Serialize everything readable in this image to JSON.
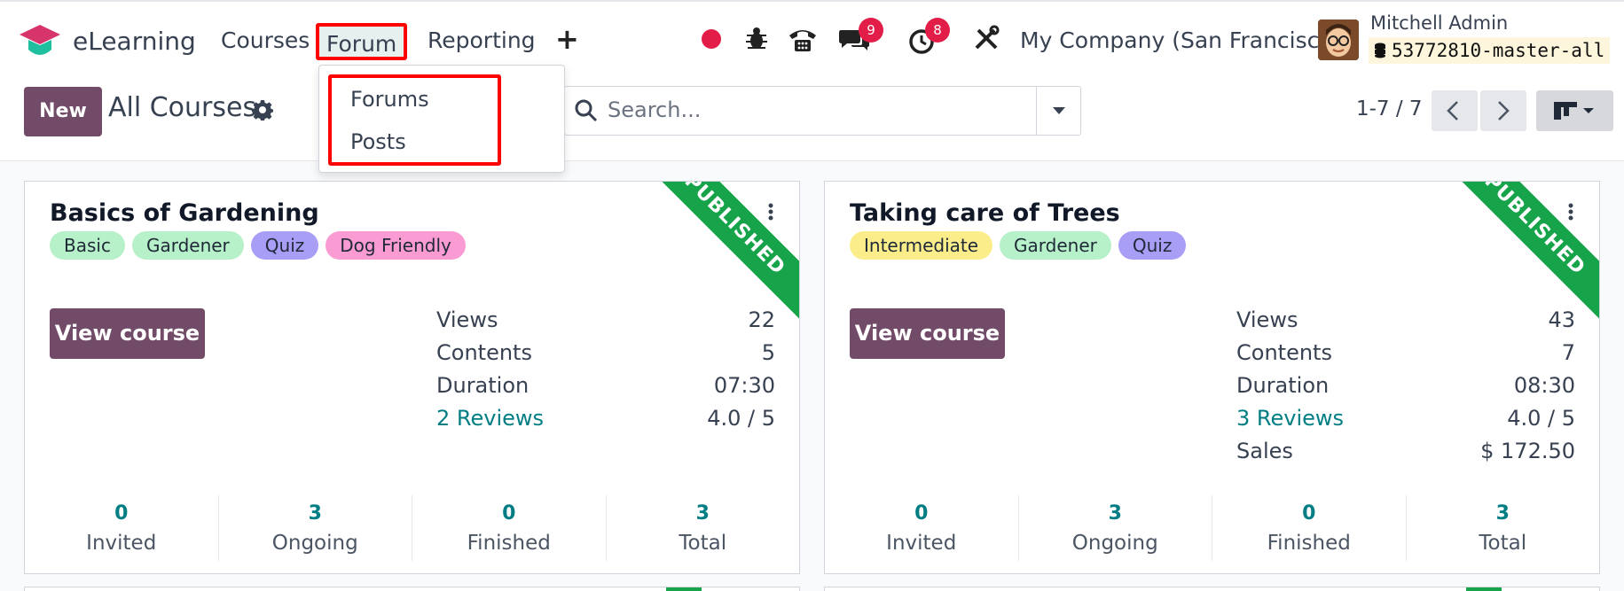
{
  "navbar": {
    "app_name": "eLearning",
    "menu": [
      "Courses",
      "Forum",
      "Reporting"
    ],
    "plus_label": "+",
    "chat_badge": "9",
    "activity_badge": "8",
    "company": "My Company (San Francisco)",
    "user_name": "Mitchell Admin",
    "database": "53772810-master-all"
  },
  "forum_dropdown": {
    "items": [
      "Forums",
      "Posts"
    ]
  },
  "control_panel": {
    "new_label": "New",
    "title": "All Courses",
    "search_placeholder": "Search...",
    "pager": "1-7 / 7"
  },
  "cards": [
    {
      "title": "Basics of Gardening",
      "ribbon": "PUBLISHED",
      "tags": [
        {
          "label": "Basic",
          "color": "#b7f1c9"
        },
        {
          "label": "Gardener",
          "color": "#b7f1c9"
        },
        {
          "label": "Quiz",
          "color": "#a99ef5"
        },
        {
          "label": "Dog Friendly",
          "color": "#fb9bd4"
        }
      ],
      "view_label": "View course",
      "stats": [
        {
          "label": "Views",
          "value": "22"
        },
        {
          "label": "Contents",
          "value": "5"
        },
        {
          "label": "Duration",
          "value": "07:30"
        },
        {
          "label": "2 Reviews",
          "value": "4.0 / 5"
        }
      ],
      "footer": [
        {
          "num": "0",
          "label": "Invited"
        },
        {
          "num": "3",
          "label": "Ongoing"
        },
        {
          "num": "0",
          "label": "Finished"
        },
        {
          "num": "3",
          "label": "Total"
        }
      ]
    },
    {
      "title": "Taking care of Trees",
      "ribbon": "PUBLISHED",
      "tags": [
        {
          "label": "Intermediate",
          "color": "#fbee8a"
        },
        {
          "label": "Gardener",
          "color": "#b7f1c9"
        },
        {
          "label": "Quiz",
          "color": "#a99ef5"
        }
      ],
      "view_label": "View course",
      "stats": [
        {
          "label": "Views",
          "value": "43"
        },
        {
          "label": "Contents",
          "value": "7"
        },
        {
          "label": "Duration",
          "value": "08:30"
        },
        {
          "label": "3 Reviews",
          "value": "4.0 / 5"
        },
        {
          "label": "Sales",
          "value": "$ 172.50"
        }
      ],
      "footer": [
        {
          "num": "0",
          "label": "Invited"
        },
        {
          "num": "3",
          "label": "Ongoing"
        },
        {
          "num": "0",
          "label": "Finished"
        },
        {
          "num": "3",
          "label": "Total"
        }
      ]
    }
  ],
  "colors": {
    "brand": "#714b67",
    "link": "#017e84",
    "ribbon": "#16a34a",
    "badge": "#e11d48",
    "highlight": "#ff0000"
  }
}
